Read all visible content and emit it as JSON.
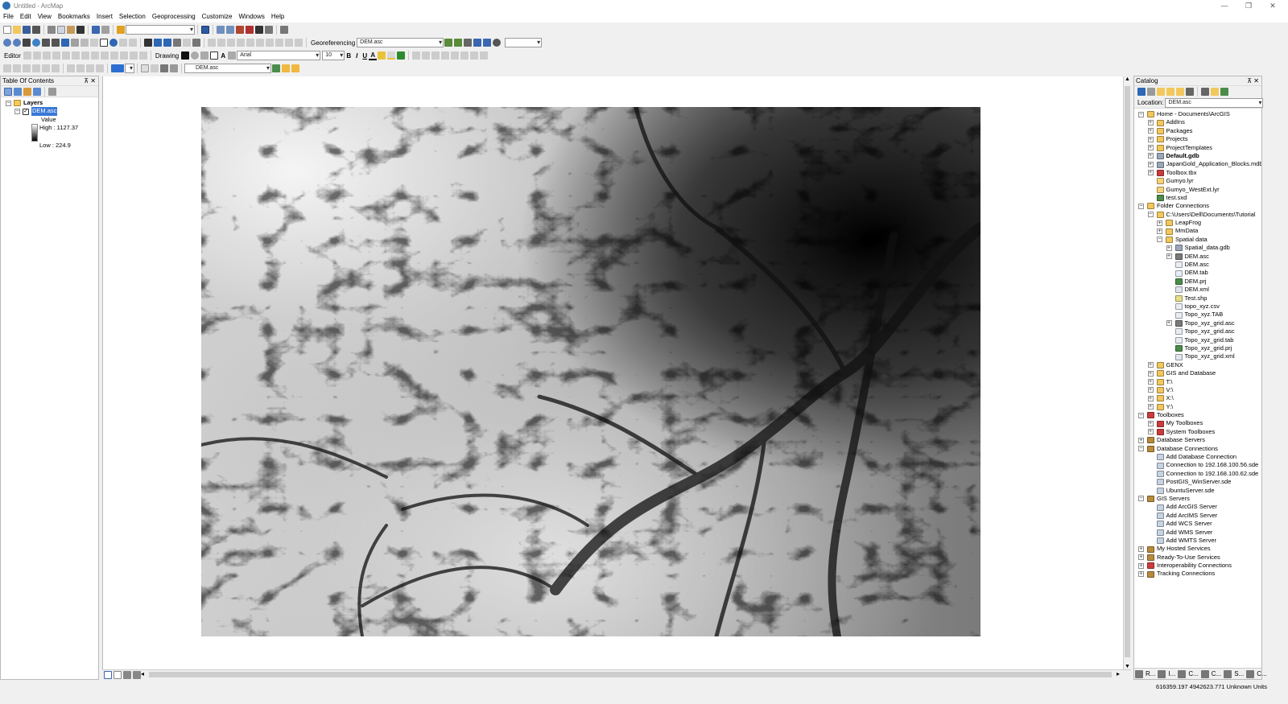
{
  "window": {
    "title": "Untitled - ArcMap"
  },
  "menu": [
    "File",
    "Edit",
    "View",
    "Bookmarks",
    "Insert",
    "Selection",
    "Geoprocessing",
    "Customize",
    "Windows",
    "Help"
  ],
  "toolbars": {
    "scale_value": "",
    "georef_label": "Georeferencing",
    "georef_layer": "DEM.asc",
    "editor_label": "Editor",
    "drawing_label": "Drawing",
    "font_name": "Arial",
    "font_size": "10",
    "bold": "B",
    "italic": "I",
    "underline": "U",
    "font_color": "A",
    "layer_combo": "DEM.asc"
  },
  "toc": {
    "title": "Table Of Contents",
    "layers_label": "Layers",
    "layer_name": "DEM.asc",
    "value_label": "Value",
    "high_label": "High : 1127.37",
    "low_label": "Low : 224.9"
  },
  "catalog": {
    "title": "Catalog",
    "location_label": "Location:",
    "location_value": "DEM.asc",
    "items": [
      {
        "label": "Home - Documents\\ArcGIS",
        "level": 0,
        "exp": "-",
        "icon": "folder"
      },
      {
        "label": "AddIns",
        "level": 1,
        "exp": "+",
        "icon": "folder"
      },
      {
        "label": "Packages",
        "level": 1,
        "exp": "+",
        "icon": "folder"
      },
      {
        "label": "Projects",
        "level": 1,
        "exp": "+",
        "icon": "folder"
      },
      {
        "label": "ProjectTemplates",
        "level": 1,
        "exp": "+",
        "icon": "folder"
      },
      {
        "label": "Default.gdb",
        "level": 1,
        "exp": "+",
        "icon": "gdb",
        "bold": true
      },
      {
        "label": "JapanGold_Application_Blocks.mdb",
        "level": 1,
        "exp": "+",
        "icon": "gdb"
      },
      {
        "label": "Toolbox.tbx",
        "level": 1,
        "exp": "+",
        "icon": "toolbox"
      },
      {
        "label": "Gumyo.lyr",
        "level": 1,
        "exp": "",
        "icon": "lyr"
      },
      {
        "label": "Gumyo_WestExt.lyr",
        "level": 1,
        "exp": "",
        "icon": "lyr"
      },
      {
        "label": "test.sxd",
        "level": 1,
        "exp": "",
        "icon": "globe"
      },
      {
        "label": "Folder Connections",
        "level": 0,
        "exp": "-",
        "icon": "folder"
      },
      {
        "label": "C:\\Users\\Dell\\Documents\\Tutorial",
        "level": 1,
        "exp": "-",
        "icon": "folder"
      },
      {
        "label": "LeapFrog",
        "level": 2,
        "exp": "+",
        "icon": "folder"
      },
      {
        "label": "MmData",
        "level": 2,
        "exp": "+",
        "icon": "folder"
      },
      {
        "label": "Spatial data",
        "level": 2,
        "exp": "-",
        "icon": "folderopen"
      },
      {
        "label": "Spatial_data.gdb",
        "level": 3,
        "exp": "+",
        "icon": "gdb"
      },
      {
        "label": "DEM.asc",
        "level": 3,
        "exp": "+",
        "icon": "raster"
      },
      {
        "label": "DEM.asc",
        "level": 3,
        "exp": "",
        "icon": "file"
      },
      {
        "label": "DEM.tab",
        "level": 3,
        "exp": "",
        "icon": "file"
      },
      {
        "label": "DEM.prj",
        "level": 3,
        "exp": "",
        "icon": "globe"
      },
      {
        "label": "DEM.xml",
        "level": 3,
        "exp": "",
        "icon": "xml"
      },
      {
        "label": "Test.shp",
        "level": 3,
        "exp": "",
        "icon": "shp"
      },
      {
        "label": "topo_xyz.csv",
        "level": 3,
        "exp": "",
        "icon": "file"
      },
      {
        "label": "Topo_xyz.TAB",
        "level": 3,
        "exp": "",
        "icon": "file"
      },
      {
        "label": "Topo_xyz_grid.asc",
        "level": 3,
        "exp": "+",
        "icon": "raster"
      },
      {
        "label": "Topo_xyz_grid.asc",
        "level": 3,
        "exp": "",
        "icon": "file"
      },
      {
        "label": "Topo_xyz_grid.tab",
        "level": 3,
        "exp": "",
        "icon": "file"
      },
      {
        "label": "Topo_xyz_grid.prj",
        "level": 3,
        "exp": "",
        "icon": "globe"
      },
      {
        "label": "Topo_xyz_grid.xml",
        "level": 3,
        "exp": "",
        "icon": "xml"
      },
      {
        "label": "GENX",
        "level": 1,
        "exp": "+",
        "icon": "folder"
      },
      {
        "label": "GIS and Database",
        "level": 1,
        "exp": "+",
        "icon": "folder"
      },
      {
        "label": "T:\\",
        "level": 1,
        "exp": "+",
        "icon": "folder"
      },
      {
        "label": "V:\\",
        "level": 1,
        "exp": "+",
        "icon": "folder"
      },
      {
        "label": "X:\\",
        "level": 1,
        "exp": "+",
        "icon": "folder"
      },
      {
        "label": "Y:\\",
        "level": 1,
        "exp": "+",
        "icon": "folder"
      },
      {
        "label": "Toolboxes",
        "level": 0,
        "exp": "-",
        "icon": "toolbox"
      },
      {
        "label": "My Toolboxes",
        "level": 1,
        "exp": "+",
        "icon": "toolbox"
      },
      {
        "label": "System Toolboxes",
        "level": 1,
        "exp": "+",
        "icon": "toolbox"
      },
      {
        "label": "Database Servers",
        "level": 0,
        "exp": "+",
        "icon": "server"
      },
      {
        "label": "Database Connections",
        "level": 0,
        "exp": "-",
        "icon": "server"
      },
      {
        "label": "Add Database Connection",
        "level": 1,
        "exp": "",
        "icon": "dbadd"
      },
      {
        "label": "Connection to 192.168.100.56.sde",
        "level": 1,
        "exp": "",
        "icon": "dbadd"
      },
      {
        "label": "Connection to 192.168.100.62.sde",
        "level": 1,
        "exp": "",
        "icon": "dbadd"
      },
      {
        "label": "PostGIS_WinServer.sde",
        "level": 1,
        "exp": "",
        "icon": "dbadd"
      },
      {
        "label": "UbuntuServer.sde",
        "level": 1,
        "exp": "",
        "icon": "dbadd"
      },
      {
        "label": "GIS Servers",
        "level": 0,
        "exp": "-",
        "icon": "server"
      },
      {
        "label": "Add ArcGIS Server",
        "level": 1,
        "exp": "",
        "icon": "dbadd"
      },
      {
        "label": "Add ArcIMS Server",
        "level": 1,
        "exp": "",
        "icon": "dbadd"
      },
      {
        "label": "Add WCS Server",
        "level": 1,
        "exp": "",
        "icon": "dbadd"
      },
      {
        "label": "Add WMS Server",
        "level": 1,
        "exp": "",
        "icon": "dbadd"
      },
      {
        "label": "Add WMTS Server",
        "level": 1,
        "exp": "",
        "icon": "dbadd"
      },
      {
        "label": "My Hosted Services",
        "level": 0,
        "exp": "+",
        "icon": "server"
      },
      {
        "label": "Ready-To-Use Services",
        "level": 0,
        "exp": "+",
        "icon": "server"
      },
      {
        "label": "Interoperability Connections",
        "level": 0,
        "exp": "+",
        "icon": "toolbox"
      },
      {
        "label": "Tracking Connections",
        "level": 0,
        "exp": "+",
        "icon": "server"
      }
    ],
    "bottom_tabs": [
      "R...",
      "I...",
      "C...",
      "C...",
      "S...",
      "C..."
    ]
  },
  "status": {
    "coords": "616359.197  4942623.771 Unknown Units"
  },
  "icon_colors": {
    "folder": "#f2c75c",
    "gdb": "#9aa7b8",
    "toolbox": "#cc3b3b",
    "lyr": "#f5d37a",
    "globe": "#4c8c4a",
    "file": "#e9eef6",
    "raster": "#7a7a7a",
    "xml": "#e0e6f0",
    "shp": "#e6e08a",
    "server": "#b88a3c",
    "dbadd": "#c7d3e4",
    "folderopen": "#f2c75c"
  }
}
